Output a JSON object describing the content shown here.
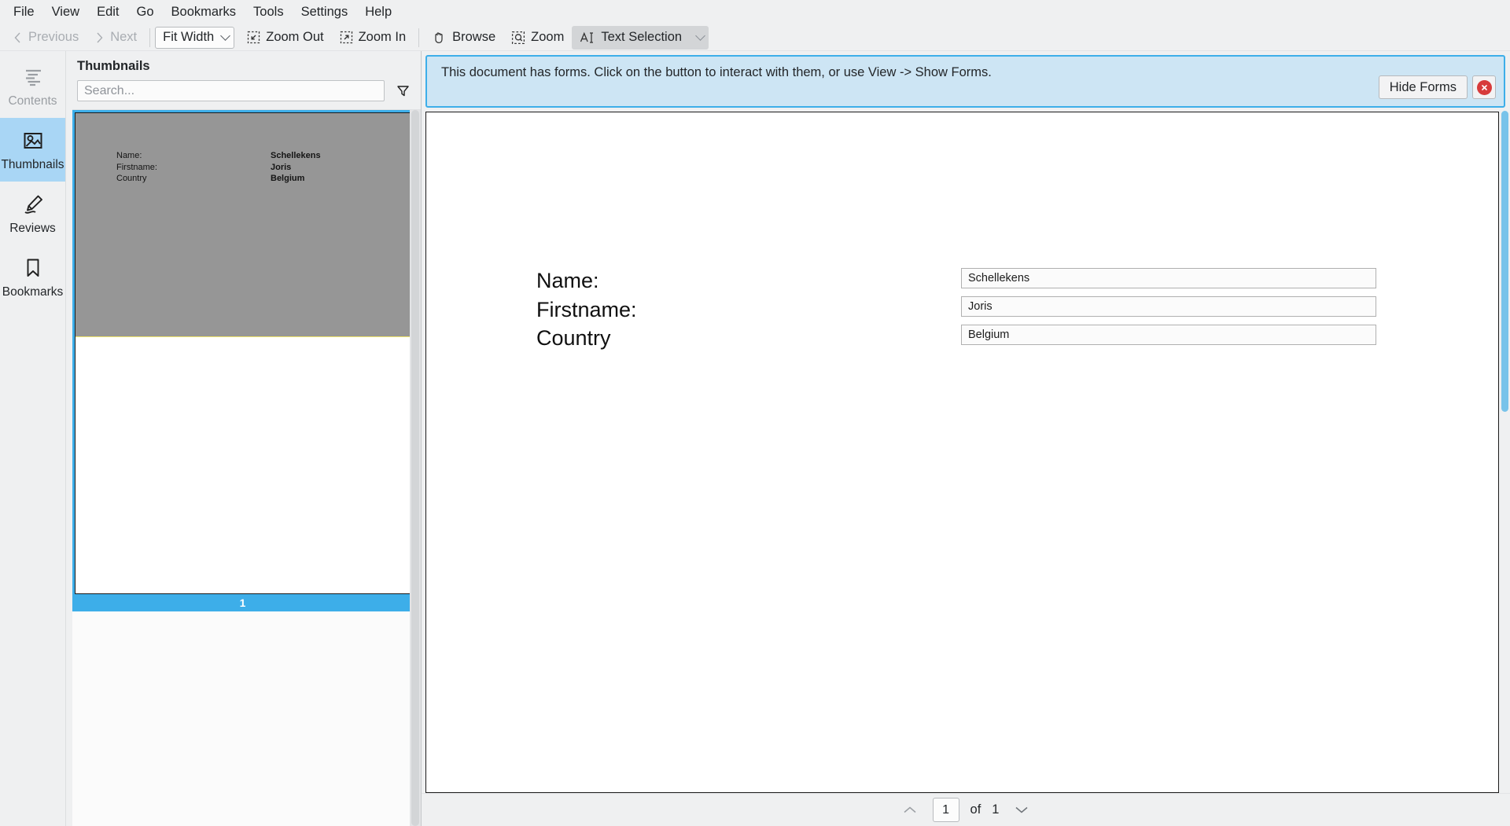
{
  "menubar": {
    "items": [
      {
        "label": "File"
      },
      {
        "label": "View"
      },
      {
        "label": "Edit"
      },
      {
        "label": "Go"
      },
      {
        "label": "Bookmarks"
      },
      {
        "label": "Tools"
      },
      {
        "label": "Settings"
      },
      {
        "label": "Help"
      }
    ]
  },
  "toolbar": {
    "previous_label": "Previous",
    "next_label": "Next",
    "zoom_mode": "Fit Width",
    "zoom_out_label": "Zoom Out",
    "zoom_in_label": "Zoom In",
    "browse_label": "Browse",
    "zoom_label": "Zoom",
    "text_selection_label": "Text Selection"
  },
  "rail": {
    "items": [
      {
        "label": "Contents",
        "icon": "contents-icon",
        "state": "disabled"
      },
      {
        "label": "Thumbnails",
        "icon": "thumbnails-icon",
        "state": "selected"
      },
      {
        "label": "Reviews",
        "icon": "reviews-icon",
        "state": "normal"
      },
      {
        "label": "Bookmarks",
        "icon": "bookmarks-icon",
        "state": "normal"
      }
    ]
  },
  "thumbnails_panel": {
    "title": "Thumbnails",
    "search_placeholder": "Search...",
    "search_value": "",
    "filter_icon": "filter-funnel-icon",
    "page_number_label": "1",
    "preview": {
      "labels": [
        "Name:",
        "Firstname:",
        "Country"
      ],
      "values": [
        "Schellekens",
        "Joris",
        "Belgium"
      ]
    }
  },
  "form_notification": {
    "message": "This document has forms. Click on the button to interact with them, or use View -> Show Forms.",
    "hide_forms_label": "Hide Forms",
    "close_icon": "close-circle-icon",
    "accent_color": "#3daee9",
    "background_color": "#cde5f4"
  },
  "document": {
    "fields": [
      {
        "label": "Name:",
        "value": "Schellekens"
      },
      {
        "label": "Firstname:",
        "value": "Joris"
      },
      {
        "label": "Country",
        "value": "Belgium"
      }
    ]
  },
  "statusbar": {
    "prev_icon": "chevron-up-icon",
    "current_page": "1",
    "of_label": "of",
    "total_pages": "1",
    "next_icon": "chevron-down-icon"
  }
}
